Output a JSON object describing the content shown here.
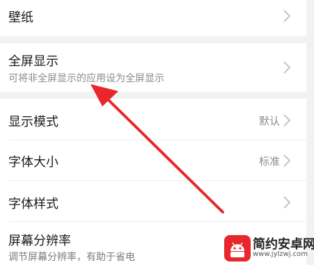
{
  "settings": {
    "wallpaper": {
      "title": "壁纸"
    },
    "fullscreen": {
      "title": "全屏显示",
      "subtitle": "可将非全屏显示的应用设为全屏显示"
    },
    "display_mode": {
      "title": "显示模式",
      "value": "默认"
    },
    "font_size": {
      "title": "字体大小",
      "value": "标准"
    },
    "font_style": {
      "title": "字体样式"
    },
    "resolution": {
      "title": "屏幕分辨率",
      "subtitle": "调节屏幕分辨率，有助于省电"
    }
  },
  "watermark": {
    "name": "简约安卓网",
    "url": "www.jylzwj.com"
  },
  "colors": {
    "background": "#f2f2f2",
    "card": "#ffffff",
    "arrow": "#e8262b"
  },
  "icons": {
    "chevron": "chevron-right-icon",
    "watermark_logo": "android-logo-icon"
  }
}
